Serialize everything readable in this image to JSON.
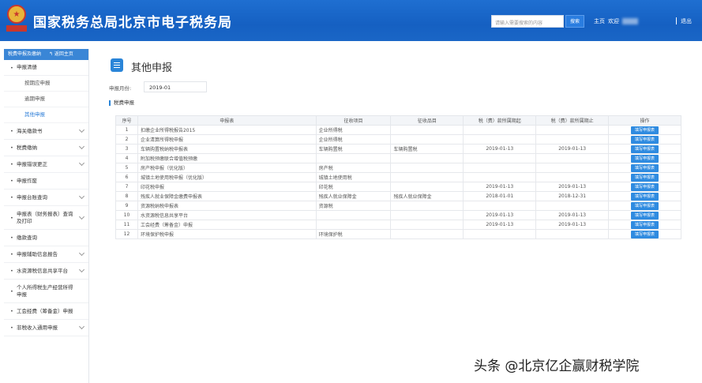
{
  "header": {
    "title": "国家税务总局北京市电子税务局",
    "search_placeholder": "请输入需要搜索的内容",
    "search_button": "搜索",
    "home_link": "主页",
    "welcome": "欢迎",
    "exit": "退出",
    "colors": {
      "bar": "#1f6fd1",
      "accent": "#2a85d8"
    }
  },
  "sidebar": {
    "top_label": "税费申报及缴纳",
    "back_label": "↰ 返回主页",
    "items": [
      {
        "label": "申报清册",
        "expandable": false
      },
      {
        "label": "按期应申报",
        "sub": true
      },
      {
        "label": "逾期申报",
        "sub": true
      },
      {
        "label": "其他申报",
        "sub": true,
        "active": true
      },
      {
        "label": "海关缴款书",
        "expandable": true
      },
      {
        "label": "税费缴纳",
        "expandable": true
      },
      {
        "label": "申报错误更正",
        "expandable": true
      },
      {
        "label": "申报作废",
        "expandable": false
      },
      {
        "label": "申报台账查询",
        "expandable": true
      },
      {
        "label": "申报表（财务报表）查询及打印",
        "expandable": true
      },
      {
        "label": "缴款查询",
        "expandable": false
      },
      {
        "label": "申报辅助信息报告",
        "expandable": true
      },
      {
        "label": "水资源税信息共享平台",
        "expandable": true
      },
      {
        "label": "个人所得税生产经营所得申报",
        "expandable": false
      },
      {
        "label": "工会经费（筹备金）申报",
        "expandable": false
      },
      {
        "label": "非税收入通用申报",
        "expandable": true
      }
    ]
  },
  "main": {
    "title": "其他申报",
    "period_label": "申报月份:",
    "period_value": "2019-01",
    "section_title": "税费申报",
    "columns": [
      "序号",
      "申报表",
      "征收项目",
      "征收品目",
      "税（费）款所属期起",
      "税（费）款所属期止",
      "操作"
    ],
    "rows": [
      [
        "1",
        "扣缴企业所得税报告2015",
        "企业所得税",
        "",
        "",
        ""
      ],
      [
        "2",
        "企业清算所得税申报",
        "企业所得税",
        "",
        "",
        ""
      ],
      [
        "3",
        "车辆购置税纳税申报表",
        "车辆购置税",
        "车辆购置税",
        "2019-01-13",
        "2019-01-13"
      ],
      [
        "4",
        "附加税预缴联合增值税预缴",
        "",
        "",
        "",
        ""
      ],
      [
        "5",
        "房产税申报（优化版）",
        "房产税",
        "",
        "",
        ""
      ],
      [
        "6",
        "城镇土地使用税申报（优化版）",
        "城镇土地使用税",
        "",
        "",
        ""
      ],
      [
        "7",
        "印花税申报",
        "印花税",
        "",
        "2019-01-13",
        "2019-01-13"
      ],
      [
        "8",
        "残疾人就业保障金缴费申报表",
        "残疾人就业保障金",
        "残疾人就业保障金",
        "2018-01-01",
        "2018-12-31"
      ],
      [
        "9",
        "资源税纳税申报表",
        "资源税",
        "",
        "",
        ""
      ],
      [
        "10",
        "水资源税信息共享平台",
        "",
        "",
        "2019-01-13",
        "2019-01-13"
      ],
      [
        "11",
        "工会经费（筹备金）申报",
        "",
        "",
        "2019-01-13",
        "2019-01-13"
      ],
      [
        "12",
        "环境保护税申报",
        "环境保护税",
        "",
        "",
        ""
      ]
    ],
    "action_label": "填写申报表"
  },
  "watermark": "头条 @北京亿企赢财税学院"
}
